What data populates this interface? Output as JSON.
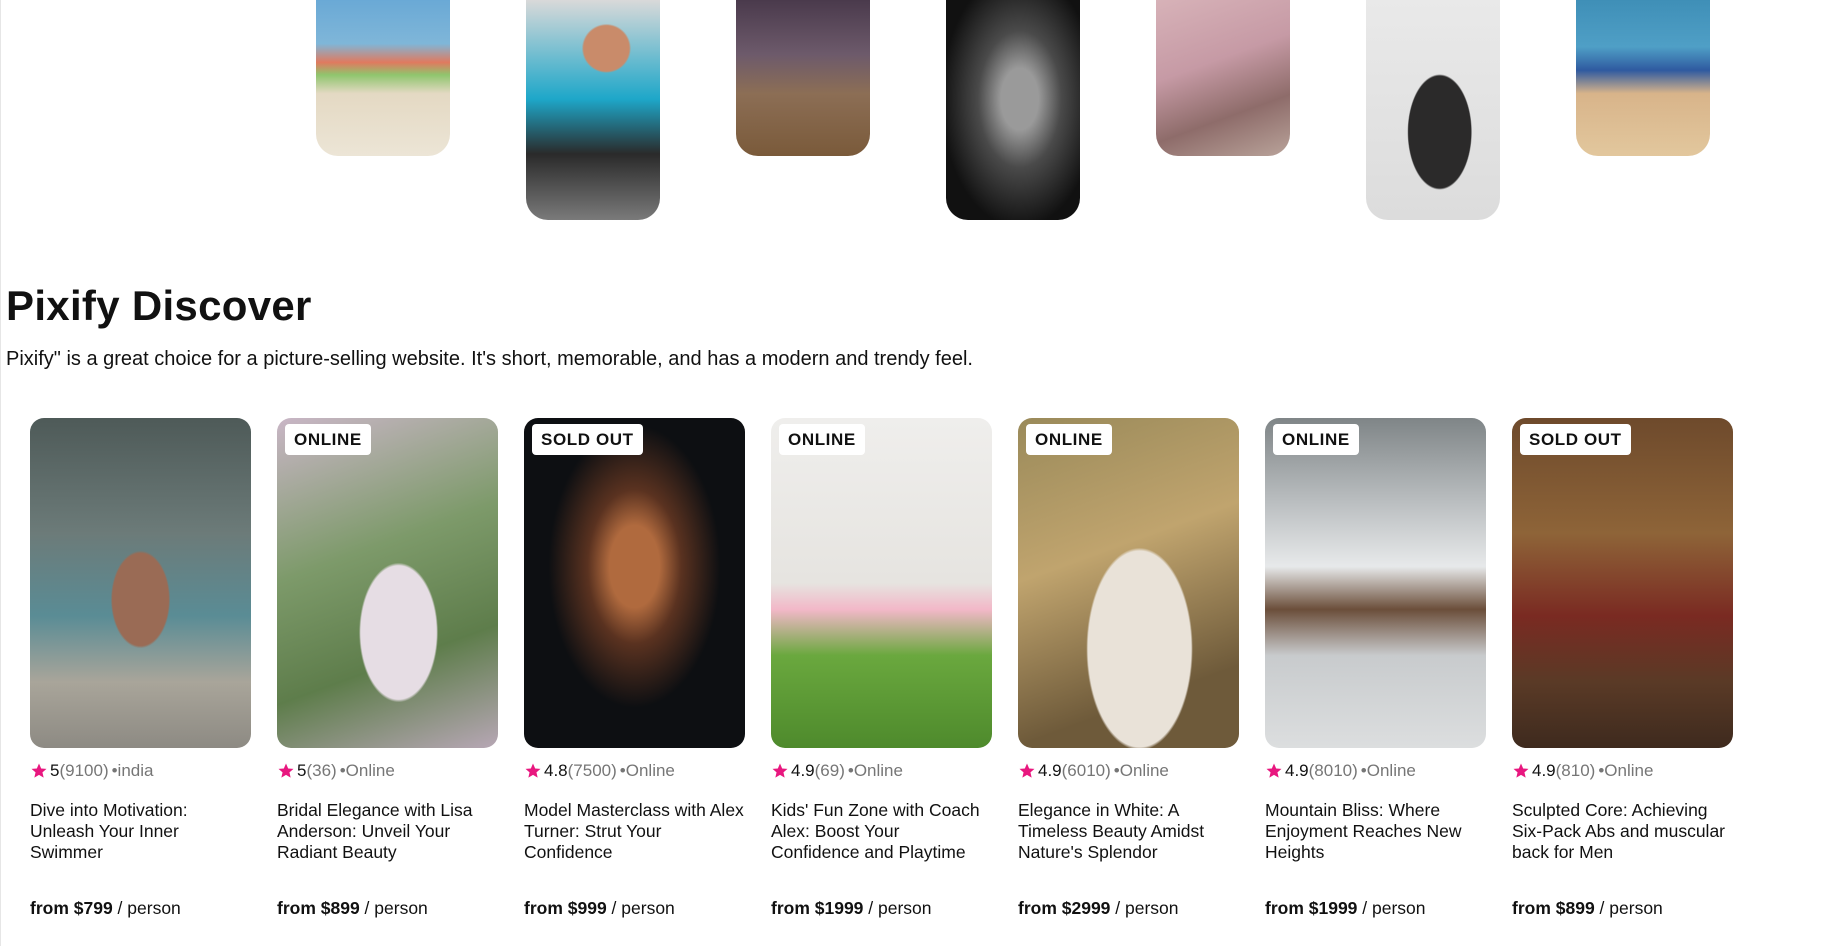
{
  "section": {
    "title": "Pixify Discover",
    "description": "Pixify\" is a great choice for a picture-selling website. It's short, memorable, and has a modern and trendy feel."
  },
  "top_photos": [
    {
      "alt": "girls-on-beach-photo"
    },
    {
      "alt": "child-with-dog-photo"
    },
    {
      "alt": "child-in-field-photo"
    },
    {
      "alt": "man-portrait-photo"
    },
    {
      "alt": "cherry-blossom-path-photo"
    },
    {
      "alt": "woman-in-snow-photo"
    },
    {
      "alt": "boy-on-beach-photo"
    }
  ],
  "cards": [
    {
      "badge": "",
      "rating": "5",
      "count": "(9100)",
      "location": "•india",
      "title": "Dive into Motivation: Unleash Your Inner Swimmer",
      "price": "from $799",
      "unit": " / person"
    },
    {
      "badge": "ONLINE",
      "rating": "5",
      "count": "(36)",
      "location": "•Online",
      "title": "Bridal Elegance with Lisa Anderson: Unveil Your Radiant Beauty",
      "price": "from $899",
      "unit": " / person"
    },
    {
      "badge": "SOLD OUT",
      "rating": "4.8",
      "count": "(7500)",
      "location": "•Online",
      "title": "Model Masterclass with Alex Turner: Strut Your Confidence",
      "price": "from $999",
      "unit": " / person"
    },
    {
      "badge": "ONLINE",
      "rating": "4.9",
      "count": "(69)",
      "location": "•Online",
      "title": "Kids' Fun Zone with Coach Alex: Boost Your Confidence and Playtime",
      "price": "from $1999",
      "unit": " / person"
    },
    {
      "badge": "ONLINE",
      "rating": "4.9",
      "count": "(6010)",
      "location": "•Online",
      "title": "Elegance in White: A Timeless Beauty Amidst Nature's Splendor",
      "price": "from $2999",
      "unit": " / person"
    },
    {
      "badge": "ONLINE",
      "rating": "4.9",
      "count": "(8010)",
      "location": "•Online",
      "title": "Mountain Bliss: Where Enjoyment Reaches New Heights",
      "price": "from $1999",
      "unit": " / person"
    },
    {
      "badge": "SOLD OUT",
      "rating": "4.9",
      "count": "(810)",
      "location": "•Online",
      "title": "Sculpted Core: Achieving Six-Pack Abs and muscular back for Men",
      "price": "from $899",
      "unit": " / person"
    }
  ],
  "colors": {
    "star": "#e8177f",
    "muted": "#767676",
    "text": "#111111"
  }
}
